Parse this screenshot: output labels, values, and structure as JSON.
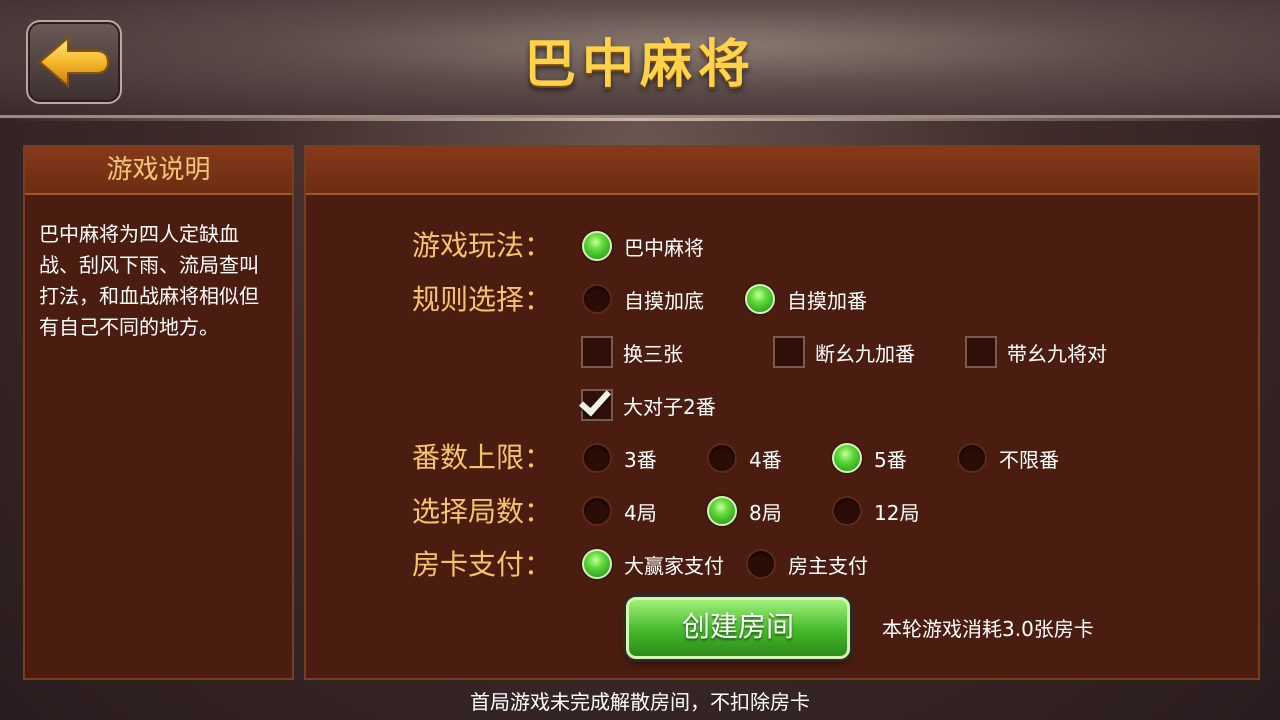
{
  "title": "巴中麻将",
  "icons": {
    "back": "back-arrow-icon"
  },
  "colors": {
    "accent_gold": "#ffd24a",
    "label_gold": "#f5c36a",
    "radio_on": "#5fd93a",
    "panel": "#4a1d10",
    "panel_header": "#7a3318"
  },
  "left_panel": {
    "header": "游戏说明",
    "description": "巴中麻将为四人定缺血战、刮风下雨、流局查叫打法，和血战麻将相似但有自己不同的地方。"
  },
  "rows": {
    "mode": {
      "label": "游戏玩法：",
      "options": [
        {
          "label": "巴中麻将",
          "selected": true
        }
      ]
    },
    "rules": {
      "label": "规则选择：",
      "radios": [
        {
          "label": "自摸加底",
          "selected": false
        },
        {
          "label": "自摸加番",
          "selected": true
        }
      ],
      "checks": [
        {
          "label": "换三张",
          "checked": false
        },
        {
          "label": "断幺九加番",
          "checked": false
        },
        {
          "label": "带幺九将对",
          "checked": false
        },
        {
          "label": "大对子2番",
          "checked": true
        }
      ]
    },
    "fan_limit": {
      "label": "番数上限：",
      "options": [
        {
          "label": "3番",
          "selected": false
        },
        {
          "label": "4番",
          "selected": false
        },
        {
          "label": "5番",
          "selected": true
        },
        {
          "label": "不限番",
          "selected": false
        }
      ]
    },
    "rounds": {
      "label": "选择局数：",
      "options": [
        {
          "label": "4局",
          "selected": false
        },
        {
          "label": "8局",
          "selected": true
        },
        {
          "label": "12局",
          "selected": false
        }
      ]
    },
    "payment": {
      "label": "房卡支付：",
      "options": [
        {
          "label": "大赢家支付",
          "selected": true
        },
        {
          "label": "房主支付",
          "selected": false
        }
      ]
    }
  },
  "create_button": "创建房间",
  "cost_note": "本轮游戏消耗3.0张房卡",
  "bottom_note": "首局游戏未完成解散房间，不扣除房卡"
}
